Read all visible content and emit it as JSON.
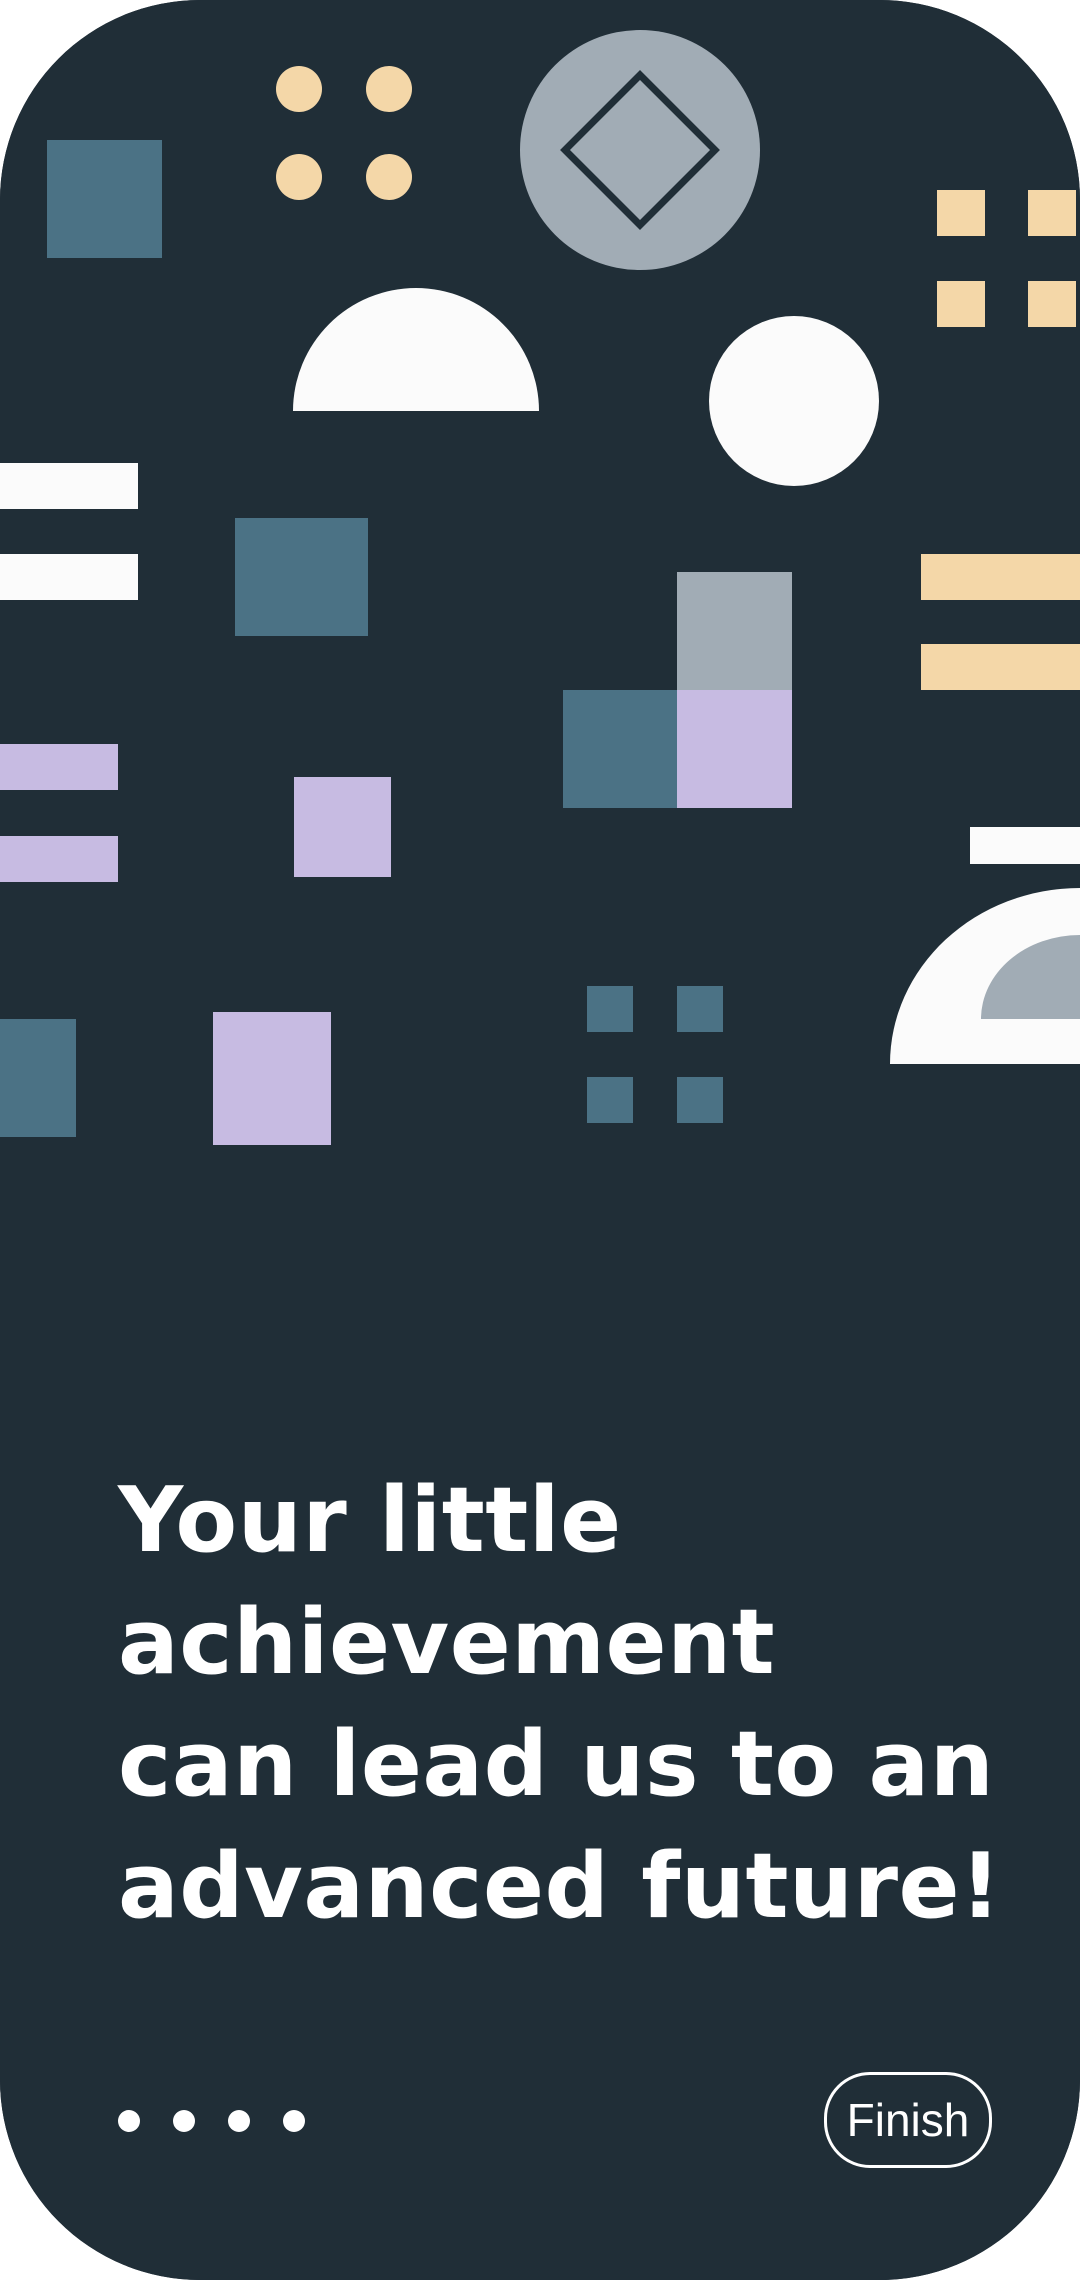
{
  "colors": {
    "background": "#202e37",
    "text": "#ffffff",
    "slate": "#4b7285",
    "gray": "#a1acb5",
    "peach": "#f4d7a8",
    "lavender": "#c7bbe2",
    "white": "#fbfbfb"
  },
  "onboarding": {
    "headline_lines": [
      "Your little",
      "achievement",
      "can lead us to an",
      "advanced future!"
    ],
    "page_count": 4,
    "finish_label": "Finish"
  },
  "illustration": {
    "icons": [
      "square-shape",
      "dot-grid-shape",
      "circle-diamond-shape",
      "square-grid-shape",
      "half-circle-shape",
      "circle-shape",
      "double-bar-shape",
      "stacked-squares-shape",
      "quarter-arc-shape"
    ]
  }
}
